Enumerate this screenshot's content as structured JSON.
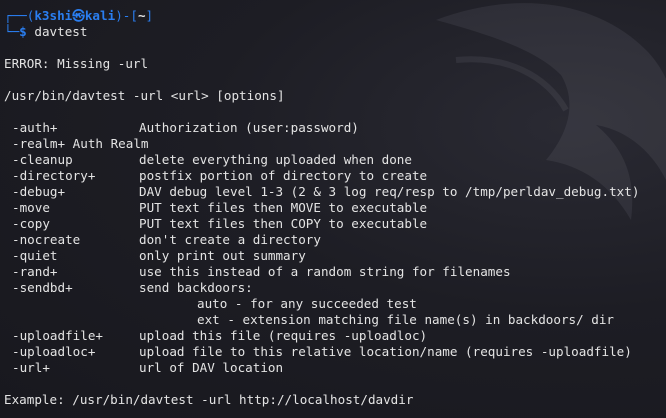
{
  "prompt": {
    "corner_top": "┌──(",
    "user_host": "k3shi㉿kali",
    "mid": ")-[",
    "path": "~",
    "end": "]",
    "corner_bottom": "└─",
    "dollar": "$",
    "command": "davtest"
  },
  "error_line": "ERROR: Missing -url",
  "usage_line": "/usr/bin/davtest -url <url> [options]",
  "options": [
    {
      "flag": "-auth+",
      "desc": "Authorization (user:password)"
    },
    {
      "flag": "-realm+ Auth Realm",
      "desc": ""
    },
    {
      "flag": "-cleanup",
      "desc": "delete everything uploaded when done"
    },
    {
      "flag": "-directory+",
      "desc": "postfix portion of directory to create"
    },
    {
      "flag": "-debug+",
      "desc": "DAV debug level 1-3 (2 & 3 log req/resp to /tmp/perldav_debug.txt)"
    },
    {
      "flag": "-move",
      "desc": "PUT text files then MOVE to executable"
    },
    {
      "flag": "-copy",
      "desc": "PUT text files then COPY to executable"
    },
    {
      "flag": "-nocreate",
      "desc": "don't create a directory"
    },
    {
      "flag": "-quiet",
      "desc": "only print out summary"
    },
    {
      "flag": "-rand+",
      "desc": "use this instead of a random string for filenames"
    },
    {
      "flag": "-sendbd+",
      "desc": "send backdoors:"
    }
  ],
  "sendbd_sub": [
    "auto - for any succeeded test",
    "ext - extension matching file name(s) in backdoors/ dir"
  ],
  "options_tail": [
    {
      "flag": "-uploadfile+",
      "desc": "upload this file (requires -uploadloc)"
    },
    {
      "flag": "-uploadloc+",
      "desc": "upload file to this relative location/name (requires -uploadfile)"
    },
    {
      "flag": "-url+",
      "desc": "url of DAV location"
    }
  ],
  "example_line": "Example: /usr/bin/davtest -url http://localhost/davdir",
  "colors": {
    "background": "#1f1f26",
    "prompt_blue": "#2a7ef0",
    "text": "#e4e4e4"
  }
}
